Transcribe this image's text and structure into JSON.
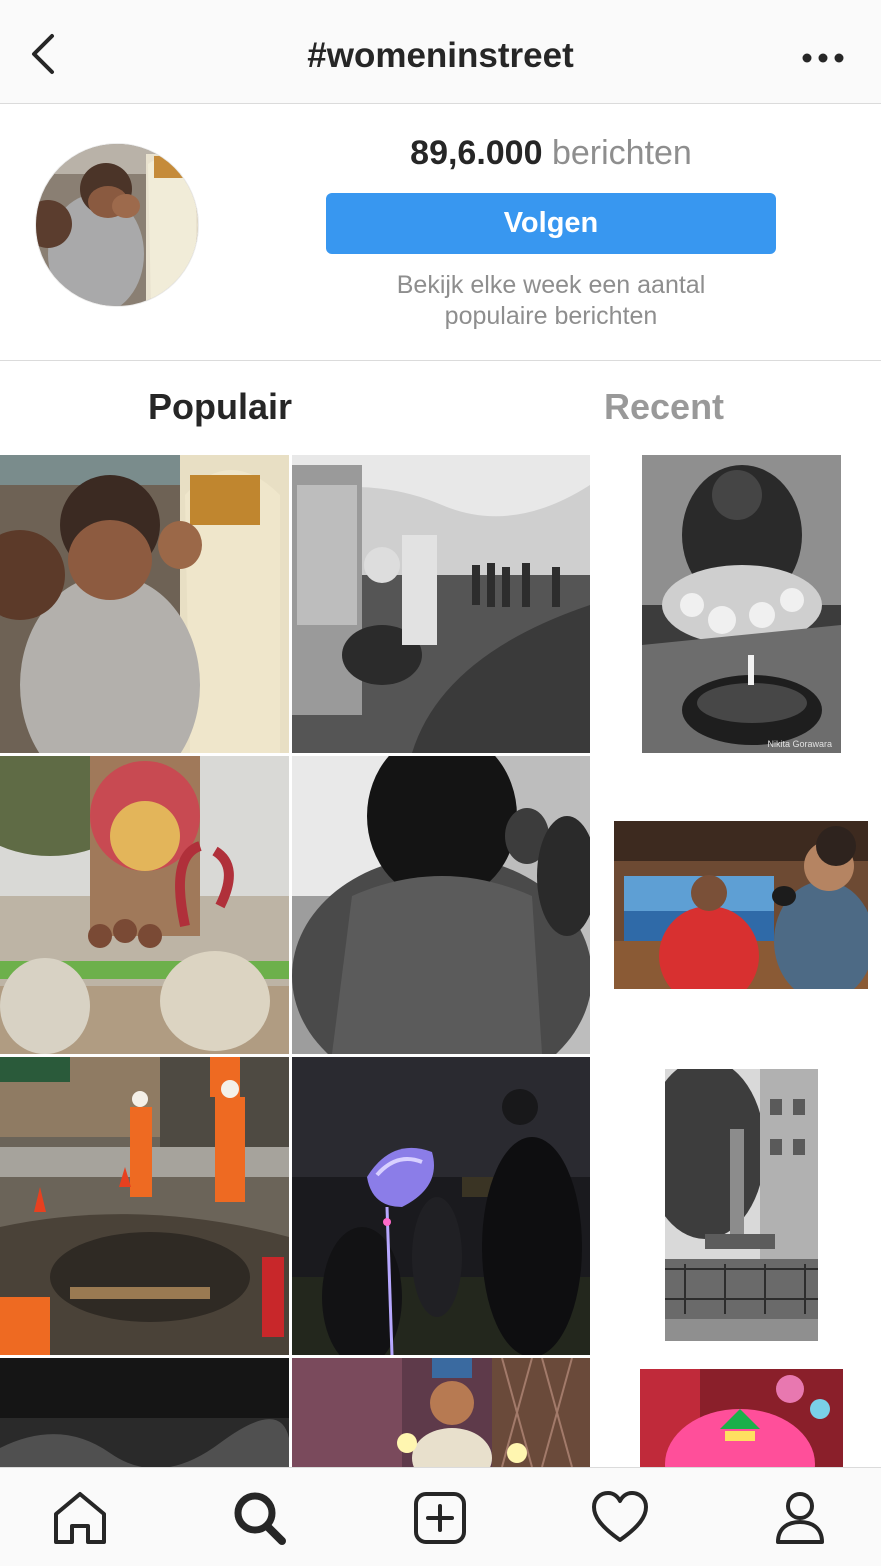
{
  "header": {
    "title": "#womeninstreet",
    "back_icon": "chevron-left-icon",
    "more_icon": "more-horizontal-icon"
  },
  "profile": {
    "post_count": "89,6.000",
    "post_label": "berichten",
    "follow_label": "Volgen",
    "hint_line1": "Bekijk elke week een aantal",
    "hint_line2": "populaire berichten"
  },
  "tabs": [
    {
      "label": "Populair",
      "active": true
    },
    {
      "label": "Recent",
      "active": false
    }
  ],
  "photos": {
    "watermark": "Nikita Gorawara"
  },
  "bottom_nav": [
    "home-icon",
    "search-icon",
    "new-post-icon",
    "activity-heart-icon",
    "profile-icon"
  ],
  "colors": {
    "accent": "#3897f0",
    "text": "#262626",
    "muted": "#8e8e8e",
    "border": "#dbdbdb",
    "bar_bg": "#fafafa"
  }
}
